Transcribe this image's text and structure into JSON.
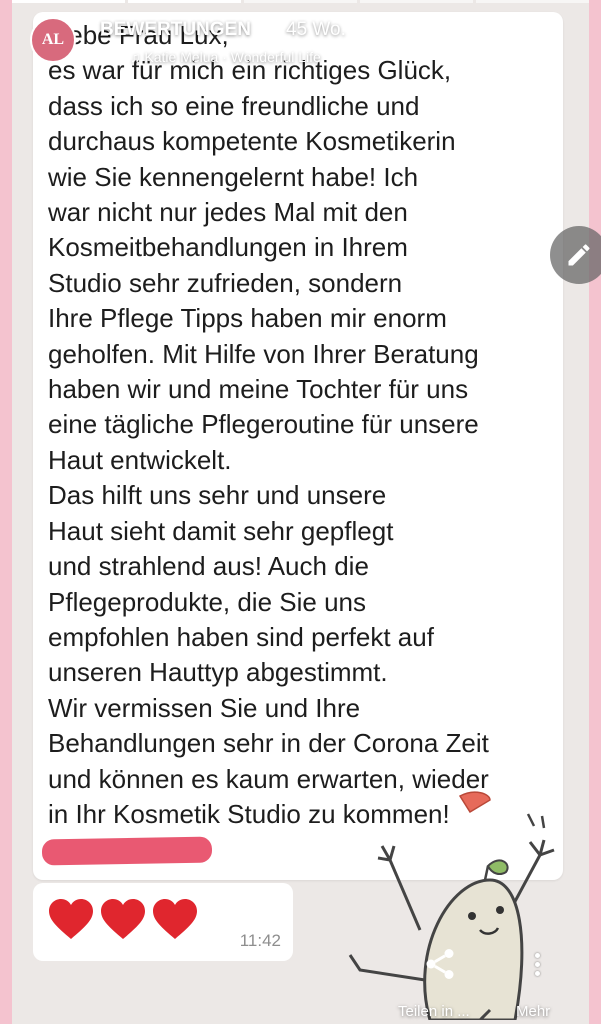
{
  "story": {
    "segments_total": 5,
    "segments_done": 2
  },
  "header": {
    "avatar_initials": "AL",
    "title": "BEWERTUNGEN",
    "age": "45 Wo.",
    "music": "♫ Katie Melua · Wonderful Life"
  },
  "message": {
    "lines": [
      "Liebe Frau Lux,",
      "es war für mich ein richtiges Glück,",
      "dass ich so eine freundliche und",
      "durchaus kompetente Kosmetikerin",
      "wie Sie kennengelernt habe! Ich",
      "war nicht nur jedes Mal mit den",
      "Kosmeitbehandlungen in Ihrem",
      "Studio sehr zufrieden, sondern",
      "Ihre Pflege Tipps haben mir enorm",
      "geholfen. Mit Hilfe von Ihrer Beratung",
      "haben wir und meine Tochter für uns",
      "eine tägliche Pflegeroutine für unsere",
      "Haut entwickelt.",
      "Das hilft uns sehr und unsere",
      "Haut sieht damit sehr gepflegt",
      "und strahlend aus! Auch die",
      "Pflegeprodukte, die Sie uns",
      "empfohlen haben sind perfekt auf",
      "unseren Hauttyp abgestimmt.",
      "Wir vermissen Sie und Ihre",
      "Behandlungen sehr in der Corona Zeit",
      "und können es kaum erwarten, wieder",
      "in Ihr Kosmetik Studio zu kommen!"
    ]
  },
  "reaction": {
    "hearts": [
      "❤",
      "❤",
      "❤"
    ],
    "time": "11:42"
  },
  "actions": {
    "share_label": "Teilen in ...",
    "more_label": "Mehr"
  },
  "colors": {
    "page_bg": "#f4c3cf",
    "heart": "#e0262e",
    "redaction": "#e8506a"
  },
  "icons": {
    "edit": "pencil-icon",
    "share": "share-icon",
    "more": "more-vertical-icon"
  }
}
